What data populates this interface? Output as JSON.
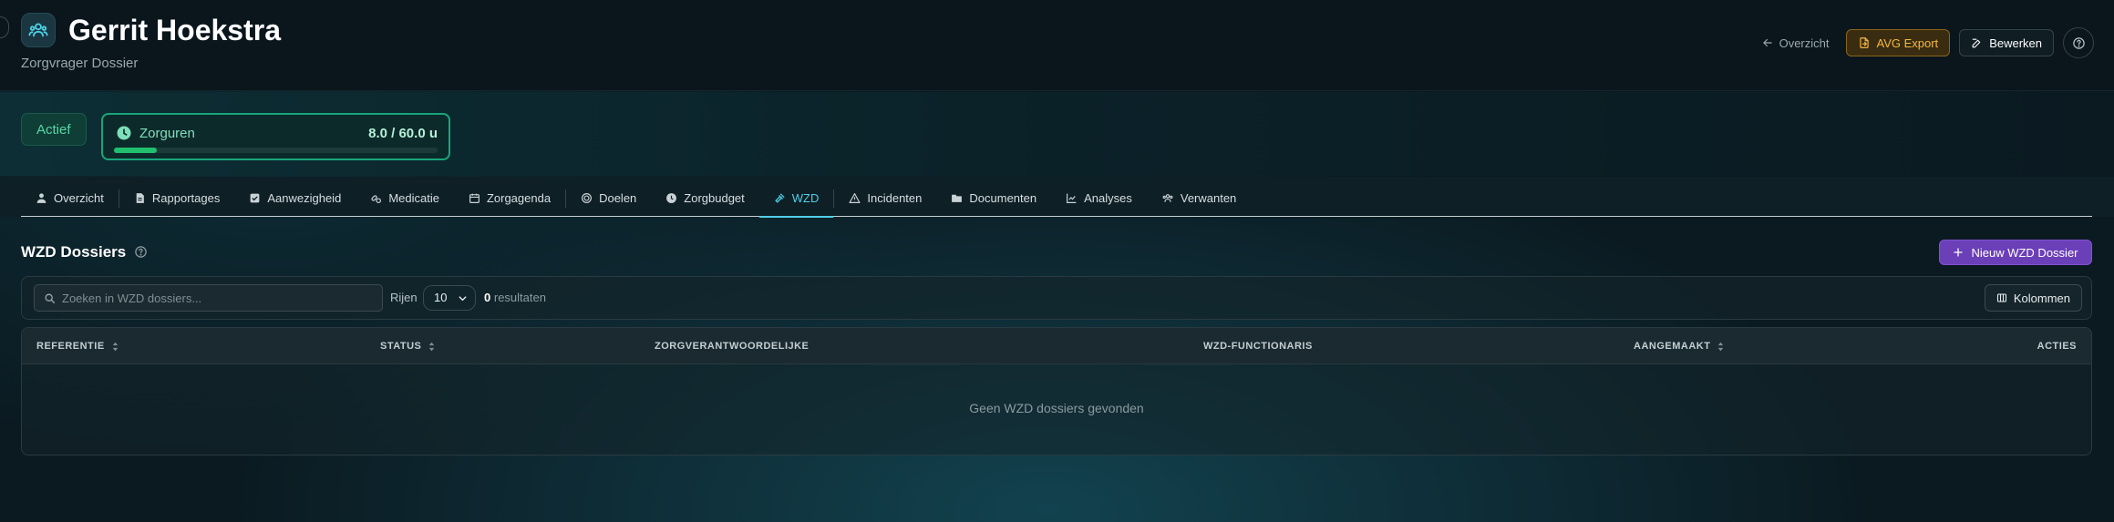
{
  "header": {
    "title": "Gerrit Hoekstra",
    "subtitle": "Zorgvrager Dossier",
    "overview_link": "Overzicht",
    "export_button": "AVG Export",
    "edit_button": "Bewerken"
  },
  "status": {
    "badge": "Actief",
    "hours_label": "Zorguren",
    "hours_value": "8.0 / 60.0 u",
    "hours_progress": 0.133
  },
  "tabs": [
    {
      "label": "Overzicht",
      "icon": "user-icon"
    },
    {
      "label": "Rapportages",
      "icon": "document-icon"
    },
    {
      "label": "Aanwezigheid",
      "icon": "checkbox-icon"
    },
    {
      "label": "Medicatie",
      "icon": "pill-icon"
    },
    {
      "label": "Zorgagenda",
      "icon": "calendar-icon"
    },
    {
      "label": "Doelen",
      "icon": "target-icon"
    },
    {
      "label": "Zorgbudget",
      "icon": "clock-icon"
    },
    {
      "label": "WZD",
      "icon": "gavel-icon",
      "active": true
    },
    {
      "label": "Incidenten",
      "icon": "warning-icon"
    },
    {
      "label": "Documenten",
      "icon": "folder-icon"
    },
    {
      "label": "Analyses",
      "icon": "chart-icon"
    },
    {
      "label": "Verwanten",
      "icon": "users-icon"
    }
  ],
  "section": {
    "title": "WZD Dossiers",
    "new_button": "Nieuw WZD Dossier"
  },
  "toolbar": {
    "search_placeholder": "Zoeken in WZD dossiers...",
    "rows_label": "Rijen",
    "rows_value": "10",
    "results_count": "0",
    "results_label": "resultaten",
    "columns_button": "Kolommen"
  },
  "table": {
    "columns": [
      "REFERENTIE",
      "STATUS",
      "ZORGVERANTWOORDELIJKE",
      "WZD-FUNCTIONARIS",
      "AANGEMAAKT",
      "ACTIES"
    ],
    "empty_text": "Geen WZD dossiers gevonden"
  },
  "colors": {
    "accent": "#4fd0e8",
    "primary": "#6b3fb8",
    "success": "#1fbf6e",
    "warning": "#f5b843"
  }
}
